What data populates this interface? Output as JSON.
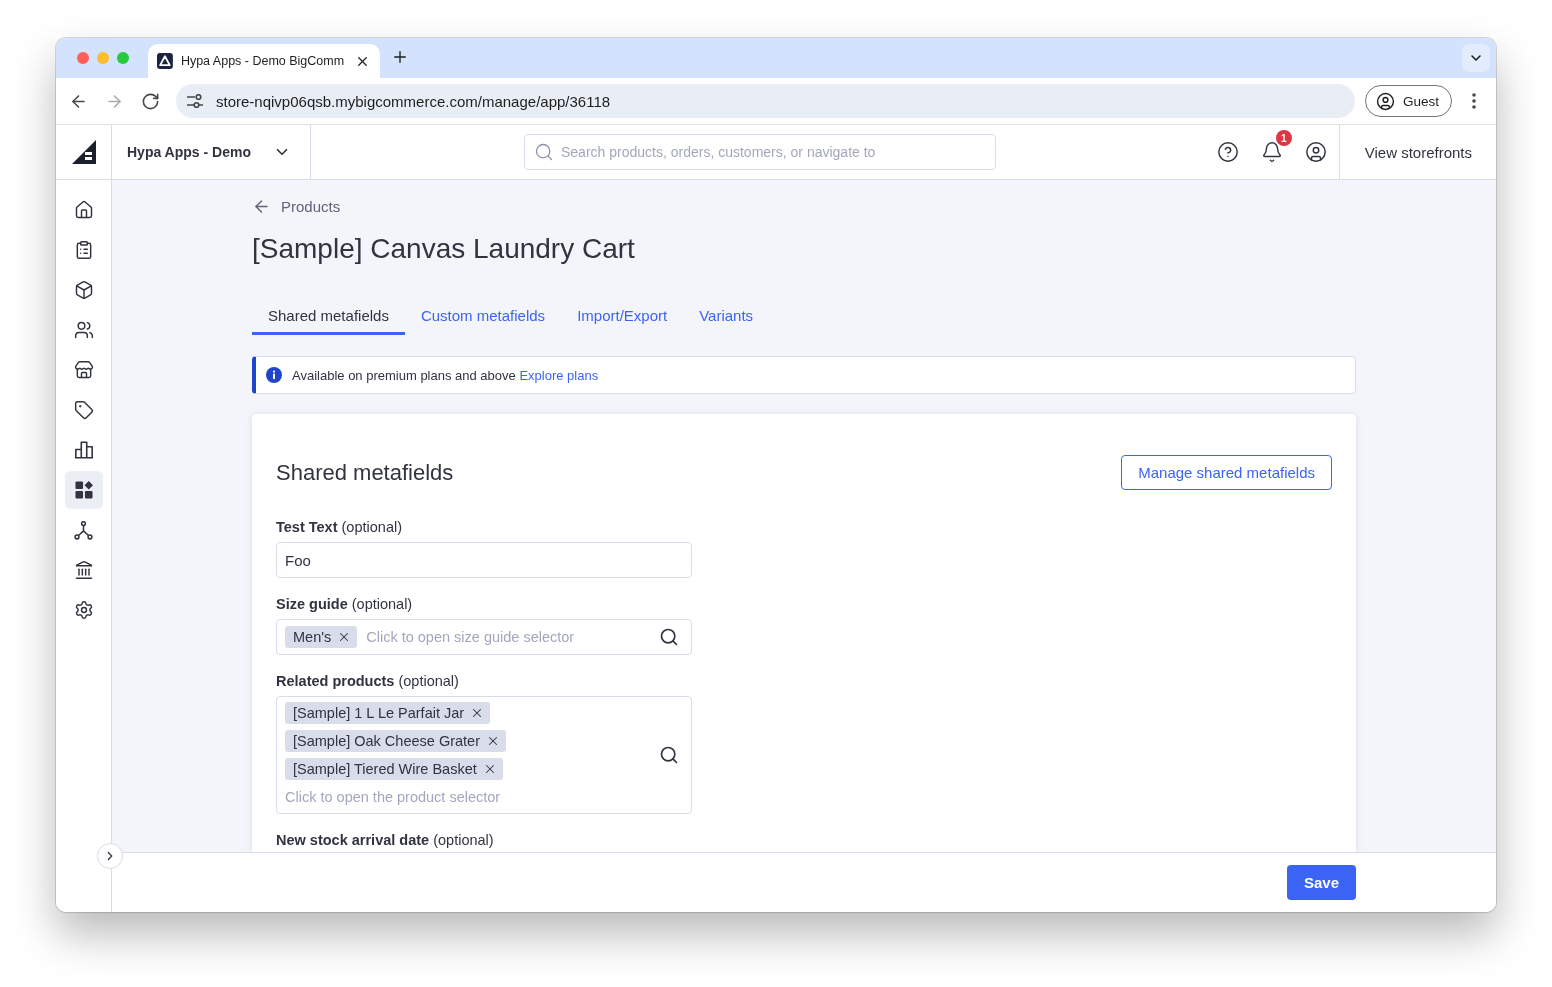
{
  "browser": {
    "tab": {
      "title": "Hypa Apps - Demo BigComm"
    },
    "nav": [
      {
        "kind": "back",
        "disabled": false
      },
      {
        "kind": "forward",
        "disabled": true
      },
      {
        "kind": "reload",
        "disabled": false
      }
    ],
    "address": "store-nqivp06qsb.mybigcommerce.com/manage/app/36118",
    "profile": "Guest"
  },
  "header": {
    "store": "Hypa Apps - Demo",
    "search": {
      "placeholder": "Search products, orders, customers, or navigate to"
    },
    "notifications": "1",
    "storefronts": "View storefronts"
  },
  "sidebar": {
    "items": [
      {
        "kind": "house",
        "selected": false
      },
      {
        "kind": "clipboard",
        "selected": false
      },
      {
        "kind": "cube",
        "selected": false
      },
      {
        "kind": "people",
        "selected": false
      },
      {
        "kind": "store",
        "selected": false
      },
      {
        "kind": "tag",
        "selected": false
      },
      {
        "kind": "bars",
        "selected": false
      },
      {
        "kind": "grid",
        "selected": true
      },
      {
        "kind": "nodes",
        "selected": false
      },
      {
        "kind": "bank",
        "selected": false
      },
      {
        "kind": "gear",
        "selected": false
      }
    ]
  },
  "page": {
    "back_link": "Products",
    "title": "[Sample] Canvas Laundry Cart",
    "tabs": [
      {
        "label": "Shared metafields",
        "selected": true
      },
      {
        "label": "Custom metafields",
        "selected": false
      },
      {
        "label": "Import/Export",
        "selected": false
      },
      {
        "label": "Variants",
        "selected": false
      }
    ],
    "banner": {
      "message": "Available on premium plans and above",
      "link": "Explore plans"
    },
    "panel": {
      "title": "Shared metafields",
      "action": "Manage shared metafields",
      "fields": [
        {
          "kind": "text",
          "label": "**Test Text** (optional)",
          "value": "Foo"
        },
        {
          "kind": "inline_picker",
          "label": "**Size guide** (optional)",
          "tags": [
            "Men's"
          ],
          "placeholder": "Click to open size guide selector"
        },
        {
          "kind": "stacked_picker",
          "label": "**Related products** (optional)",
          "tags": [
            "[Sample] 1 L Le Parfait Jar",
            "[Sample] Oak Cheese Grater",
            "[Sample] Tiered Wire Basket"
          ],
          "placeholder": "Click to open the product selector"
        },
        {
          "kind": "date",
          "label": "**New stock arrival date** (optional)"
        }
      ]
    }
  },
  "footer": {
    "save": "Save"
  }
}
